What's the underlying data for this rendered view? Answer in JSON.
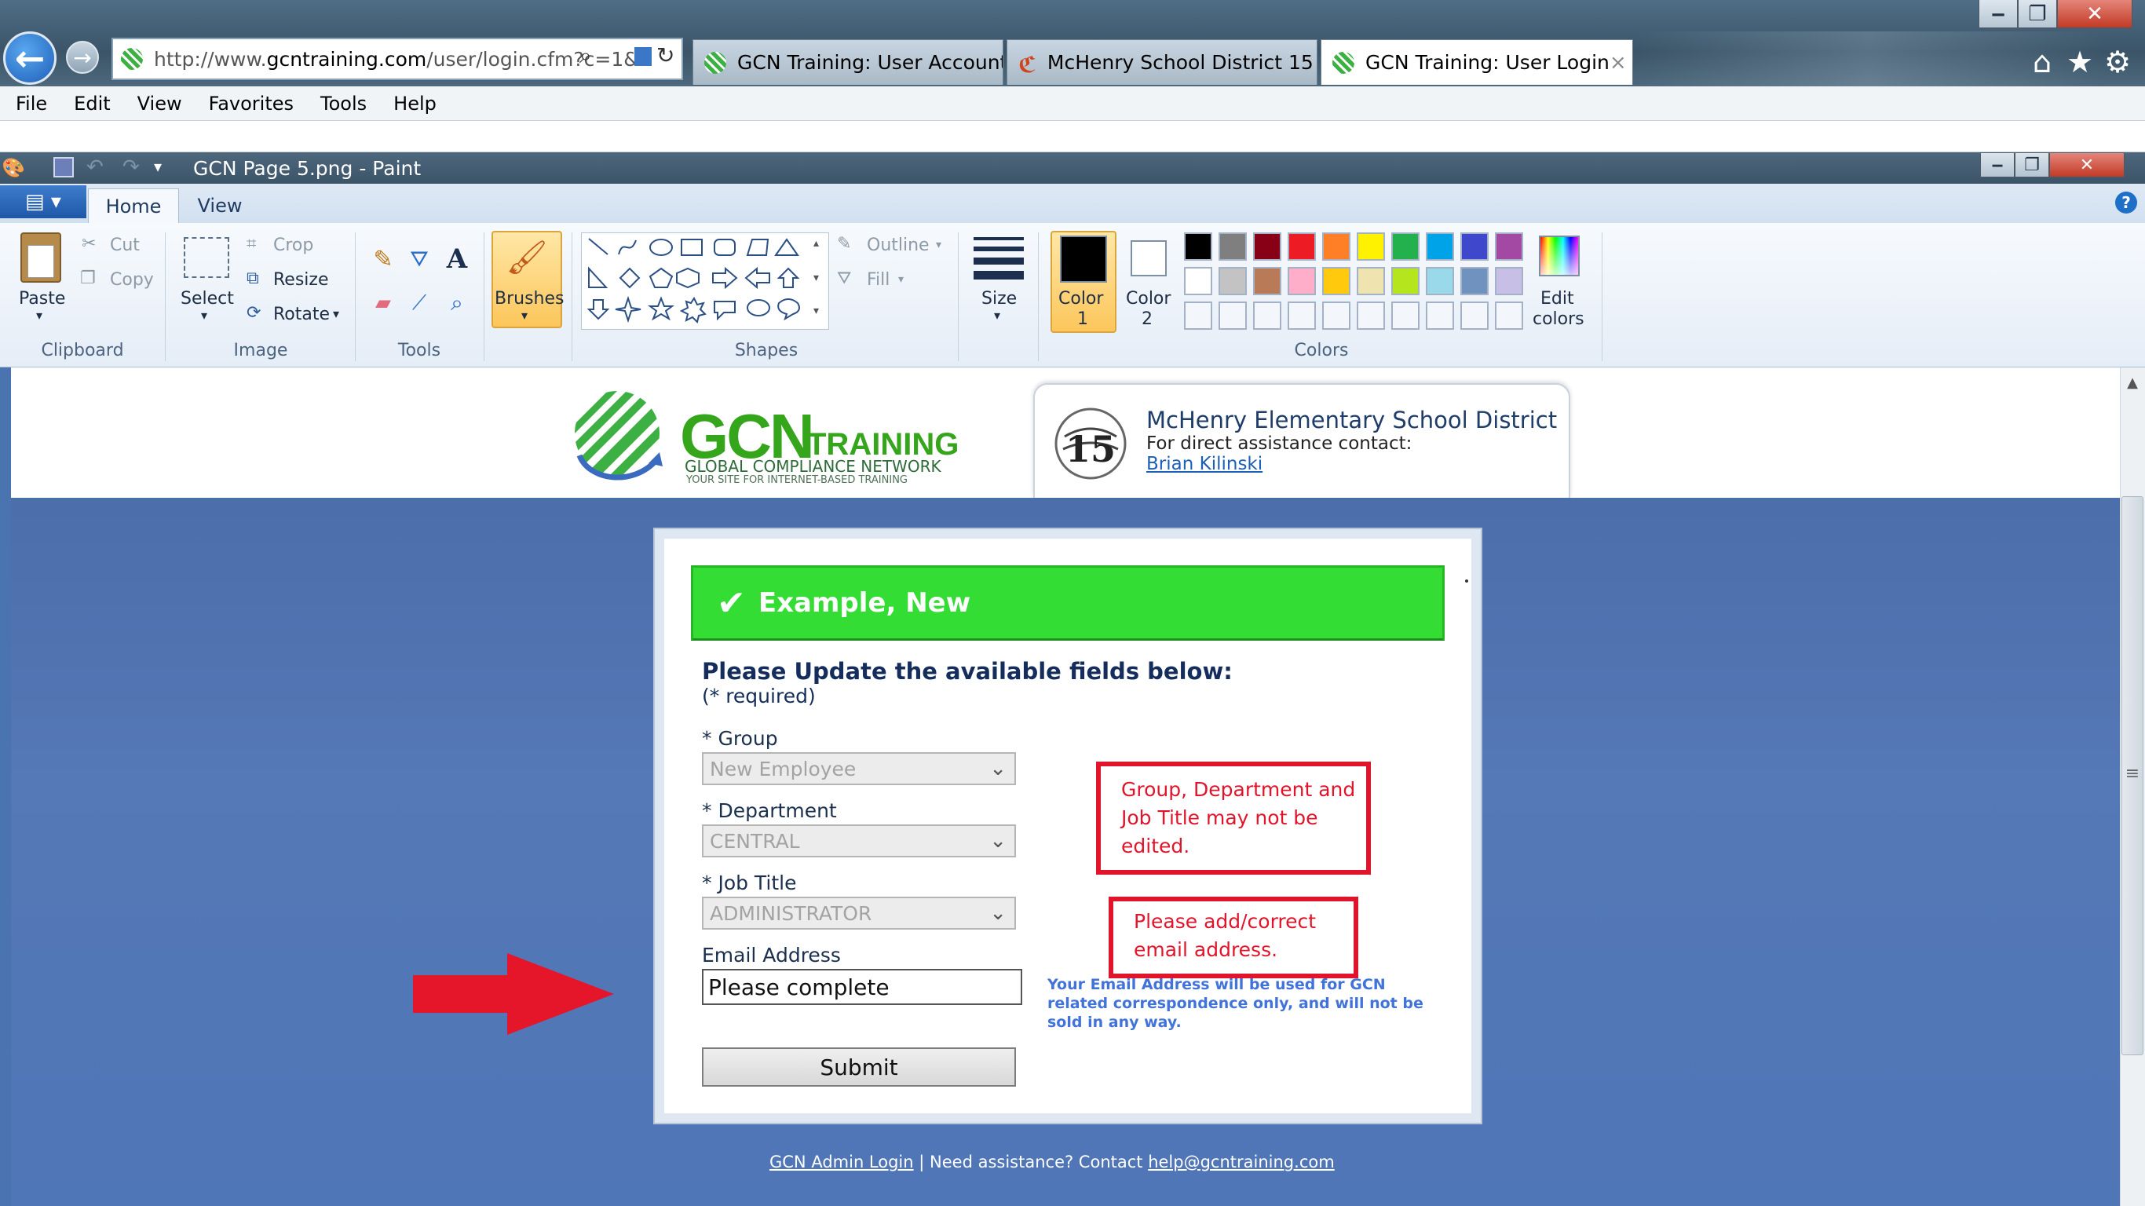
{
  "browser": {
    "address": {
      "prefix": "http://www.",
      "domain": "gcntraining.com",
      "path": "/user/login.cfm?c=1&"
    },
    "tabs": [
      {
        "label": "GCN Training: User Accounts"
      },
      {
        "label": "McHenry School District 15"
      },
      {
        "label": "GCN Training: User Login"
      }
    ],
    "close_tab": "×",
    "menu": [
      "File",
      "Edit",
      "View",
      "Favorites",
      "Tools",
      "Help"
    ],
    "window_buttons": {
      "minimize": "‒",
      "restore": "❐",
      "close": "✕"
    }
  },
  "paint": {
    "title": "GCN Page 5.png - Paint",
    "tabs": {
      "home": "Home",
      "view": "View"
    },
    "clipboard": {
      "paste": "Paste",
      "cut": "Cut",
      "copy": "Copy",
      "group": "Clipboard"
    },
    "image": {
      "select": "Select",
      "crop": "Crop",
      "resize": "Resize",
      "rotate": "Rotate",
      "group": "Image"
    },
    "tools": {
      "group": "Tools"
    },
    "brushes": "Brushes",
    "shapes": {
      "group": "Shapes",
      "outline": "Outline",
      "fill": "Fill"
    },
    "size": "Size",
    "colors": {
      "color1_label": "Color",
      "color1_num": "1",
      "color2_label": "Color",
      "color2_num": "2",
      "edit_label": "Edit",
      "edit_label2": "colors",
      "group": "Colors",
      "color1": "#000000",
      "color2": "#ffffff",
      "palette_row1": [
        "#000000",
        "#7f7f7f",
        "#880015",
        "#ed1c24",
        "#ff7f27",
        "#fff200",
        "#22b14c",
        "#00a2e8",
        "#3f48cc",
        "#a349a4"
      ],
      "palette_row2": [
        "#ffffff",
        "#c3c3c3",
        "#b97a57",
        "#ffaec9",
        "#ffc90e",
        "#efe4b0",
        "#b5e61d",
        "#99d9ea",
        "#7092be",
        "#c8bfe7"
      ]
    }
  },
  "page": {
    "logo": {
      "word": "GCN",
      "training": "TRAINING",
      "global": "GLOBAL COMPLIANCE NETWORK",
      "tagline": "YOUR SITE FOR INTERNET-BASED TRAINING"
    },
    "district": {
      "name": "McHenry Elementary School District",
      "contact": "For direct assistance contact:",
      "contact_name": "Brian Kilinski"
    },
    "banner": {
      "name": "Example, New",
      "check": "✔"
    },
    "form": {
      "heading": "Please Update the available fields below:",
      "required": "(* required)",
      "group_label": "* Group",
      "group_value": "New Employee",
      "department_label": "* Department",
      "department_value": "CENTRAL",
      "job_label": "* Job Title",
      "job_value": "ADMINISTRATOR",
      "email_label": "Email Address",
      "email_value": "Please complete",
      "submit": "Submit",
      "email_note": "Your Email Address will be used for GCN related correspondence only, and will not be sold in any way."
    },
    "callouts": {
      "locked_fields": "Group, Department and Job Title may not be edited.",
      "email": "Please add/correct email address."
    },
    "footer": {
      "admin_login": "GCN Admin Login",
      "sep": "|",
      "assist": "Need assistance? Contact",
      "email": "help@gcntraining.com"
    }
  }
}
